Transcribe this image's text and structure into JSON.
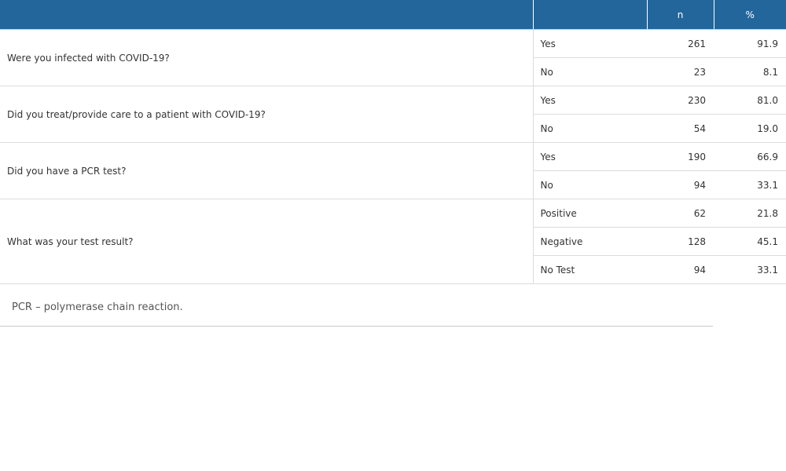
{
  "table": {
    "headers": [
      "",
      "",
      "n",
      "%"
    ],
    "questions": [
      {
        "question": "Were you infected with COVID-19?",
        "answers": [
          {
            "label": "Yes",
            "n": "261",
            "pct": "91.9"
          },
          {
            "label": "No",
            "n": "23",
            "pct": "8.1"
          }
        ]
      },
      {
        "question": "Did you treat/provide care to a patient with COVID-19?",
        "answers": [
          {
            "label": "Yes",
            "n": "230",
            "pct": "81.0"
          },
          {
            "label": "No",
            "n": "54",
            "pct": "19.0"
          }
        ]
      },
      {
        "question": "Did you have a PCR test?",
        "answers": [
          {
            "label": "Yes",
            "n": "190",
            "pct": "66.9"
          },
          {
            "label": "No",
            "n": "94",
            "pct": "33.1"
          }
        ]
      },
      {
        "question": "What was your test result?",
        "answers": [
          {
            "label": "Positive",
            "n": "62",
            "pct": "21.8"
          },
          {
            "label": "Negative",
            "n": "128",
            "pct": "45.1"
          },
          {
            "label": "No Test",
            "n": "94",
            "pct": "33.1"
          }
        ]
      }
    ]
  },
  "footnote": "PCR – polymerase chain reaction.",
  "colors": {
    "header_bg": "#23669c",
    "header_text": "#ffffff"
  }
}
